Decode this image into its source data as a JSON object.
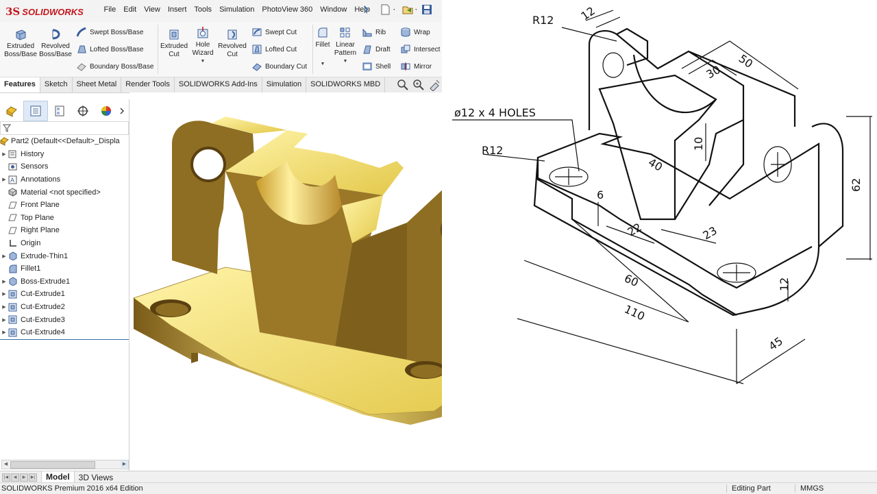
{
  "app": {
    "logo_ds": "3S",
    "logo_name": "SOLIDWORKS",
    "menu": [
      "File",
      "Edit",
      "View",
      "Insert",
      "Tools",
      "Simulation",
      "PhotoView 360",
      "Window",
      "Help"
    ]
  },
  "commands": {
    "extruded_boss": [
      "Extruded",
      "Boss/Base"
    ],
    "revolved_boss": [
      "Revolved",
      "Boss/Base"
    ],
    "swept_boss": "Swept Boss/Base",
    "lofted_boss": "Lofted Boss/Base",
    "boundary_boss": "Boundary Boss/Base",
    "extruded_cut": [
      "Extruded",
      "Cut"
    ],
    "hole_wizard": [
      "Hole",
      "Wizard"
    ],
    "revolved_cut": [
      "Revolved",
      "Cut"
    ],
    "swept_cut": "Swept Cut",
    "lofted_cut": "Lofted Cut",
    "boundary_cut": "Boundary Cut",
    "fillet": "Fillet",
    "linear_pattern": [
      "Linear",
      "Pattern"
    ],
    "rib": "Rib",
    "draft": "Draft",
    "shell": "Shell",
    "wrap": "Wrap",
    "intersect": "Intersect",
    "mirror": "Mirror"
  },
  "tabs": [
    "Features",
    "Sketch",
    "Sheet Metal",
    "Render Tools",
    "SOLIDWORKS Add-Ins",
    "Simulation",
    "SOLIDWORKS MBD"
  ],
  "tree": {
    "root": "Part2  (Default<<Default>_Displa",
    "items": [
      {
        "label": "History",
        "expand": true
      },
      {
        "label": "Sensors",
        "expand": false
      },
      {
        "label": "Annotations",
        "expand": true
      },
      {
        "label": "Material <not specified>",
        "expand": false
      },
      {
        "label": "Front Plane",
        "expand": false
      },
      {
        "label": "Top Plane",
        "expand": false
      },
      {
        "label": "Right Plane",
        "expand": false
      },
      {
        "label": "Origin",
        "expand": false
      },
      {
        "label": "Extrude-Thin1",
        "expand": true
      },
      {
        "label": "Fillet1",
        "expand": false
      },
      {
        "label": "Boss-Extrude1",
        "expand": true
      },
      {
        "label": "Cut-Extrude1",
        "expand": true
      },
      {
        "label": "Cut-Extrude2",
        "expand": true
      },
      {
        "label": "Cut-Extrude3",
        "expand": true
      },
      {
        "label": "Cut-Extrude4",
        "expand": true
      }
    ]
  },
  "bottom_tabs": [
    "Model",
    "3D Views"
  ],
  "status": {
    "edition": "SOLIDWORKS Premium 2016 x64 Edition",
    "mode": "Editing Part",
    "units": "MMGS"
  },
  "drawing": {
    "r12_top": "R12",
    "d12": "12",
    "d50": "50",
    "d30": "30",
    "holes": "ø12 x 4 HOLES",
    "d10": "10",
    "r12_left": "R12",
    "d40": "40",
    "d62": "62",
    "d6": "6",
    "d22": "22",
    "d23": "23",
    "d60": "60",
    "d110": "110",
    "d12_side": "12",
    "d45": "45"
  },
  "colors": {
    "brand_red": "#c4161c",
    "part_gold": "#e8d35a",
    "part_dark": "#8a6a1c",
    "tab_active": "#ffffff"
  }
}
